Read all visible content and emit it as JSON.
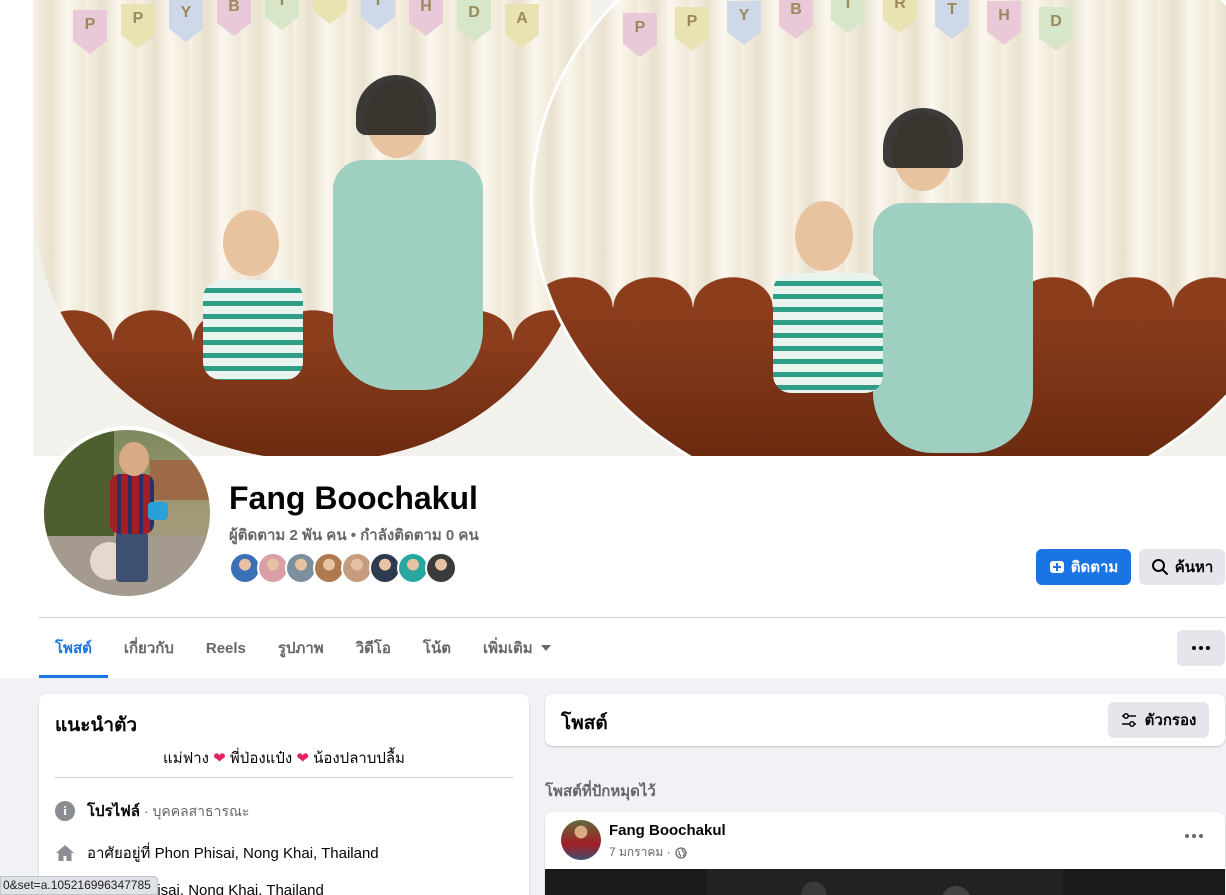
{
  "profile": {
    "name": "Fang Boochakul",
    "followers_text": "ผู้ติดตาม 2 พัน คน • กำลังติดตาม 0 คน",
    "friend_avatar_colors": [
      "#3b6fb6",
      "#d9a0a8",
      "#7c8f9c",
      "#b07a4f",
      "#c79b7e",
      "#2d3a4f",
      "#2aa6a0",
      "#3b3b3b"
    ]
  },
  "cover": {
    "banner_letters_left": [
      "P",
      "P",
      "Y",
      "B",
      "I",
      "R",
      "T",
      "H",
      "D",
      "A"
    ],
    "banner_letters_right": [
      "P",
      "P",
      "Y",
      "B",
      "I",
      "R",
      "T",
      "H",
      "D"
    ]
  },
  "actions": {
    "follow_label": "ติดตาม",
    "search_label": "ค้นหา"
  },
  "tabs": [
    {
      "label": "โพสต์",
      "active": true
    },
    {
      "label": "เกี่ยวกับ",
      "active": false
    },
    {
      "label": "Reels",
      "active": false
    },
    {
      "label": "รูปภาพ",
      "active": false
    },
    {
      "label": "วิดีโอ",
      "active": false
    },
    {
      "label": "โน้ต",
      "active": false
    },
    {
      "label": "เพิ่มเติม",
      "active": false
    }
  ],
  "intro": {
    "title": "แนะนำตัว",
    "bio_part1": "แม่ฟาง",
    "bio_part2": "พี่ป่องแป๋ง",
    "bio_part3": "น้องปลาบปลื้ม",
    "profile_label": "โปรไฟล์",
    "profile_type": " · บุคคลสาธารณะ",
    "lives_in": "อาศัยอยู่ที่ Phon Phisai, Nong Khai, Thailand",
    "from": "Phisai, Nong Khai, Thailand"
  },
  "posts": {
    "title": "โพสต์",
    "filter_label": "ตัวกรอง",
    "pinned_label": "โพสต์ที่ปักหมุดไว้"
  },
  "post": {
    "author": "Fang Boochakul",
    "date": "7 มกราคม ·"
  },
  "status_bar": {
    "url": "0&set=a.105216996347785"
  },
  "colors": {
    "accent": "#1b74e4",
    "secondary_button": "#e4e6eb",
    "page_bg": "#f0f2f5",
    "heart": "#e0245e"
  }
}
